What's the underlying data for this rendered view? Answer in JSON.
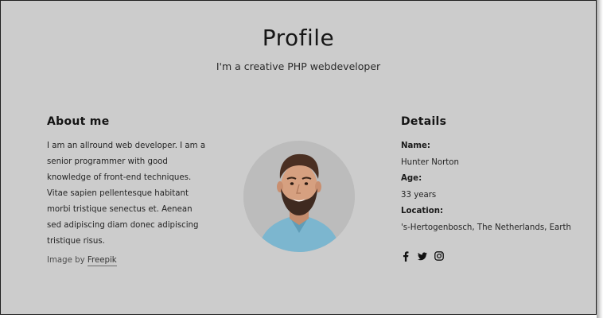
{
  "header": {
    "title": "Profile",
    "subtitle": "I'm a creative PHP webdeveloper"
  },
  "about": {
    "heading": "About me",
    "text": "I am an allround web developer. I am a senior programmer with good knowledge of front-end techniques. Vitae sapien pellentesque habitant morbi tristique senectus et. Aenean sed adipiscing diam donec adipiscing tristique risus.",
    "credit_prefix": "Image by ",
    "credit_link": "Freepik"
  },
  "details": {
    "heading": "Details",
    "items": [
      {
        "label": "Name:",
        "value": "Hunter Norton"
      },
      {
        "label": "Age:",
        "value": "33 years"
      },
      {
        "label": "Location:",
        "value": "'s-Hertogenbosch, The Netherlands, Earth"
      }
    ]
  },
  "socials": [
    "facebook-icon",
    "twitter-icon",
    "instagram-icon"
  ],
  "colors": {
    "background": "#cccccc",
    "text": "#1b1b1b"
  }
}
